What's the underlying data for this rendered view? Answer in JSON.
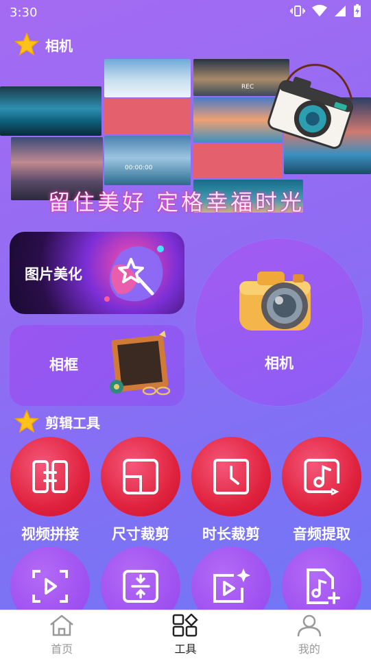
{
  "status_bar": {
    "time": "3:30"
  },
  "sections": {
    "camera_title": "相机",
    "edit_title": "剪辑工具"
  },
  "banner": {
    "caption": "留住美好  定格幸福时光",
    "rec_label": "REC",
    "timecode": "00:00:00"
  },
  "cards": {
    "beautify": "图片美化",
    "frame": "相框",
    "camera": "相机"
  },
  "tools_row1": [
    {
      "label": "视频拼接",
      "icon": "video-join-icon"
    },
    {
      "label": "尺寸裁剪",
      "icon": "resize-crop-icon"
    },
    {
      "label": "时长裁剪",
      "icon": "duration-crop-icon"
    },
    {
      "label": "音频提取",
      "icon": "audio-extract-icon"
    }
  ],
  "tools_row2": [
    {
      "icon": "scan-video-icon"
    },
    {
      "icon": "compress-icon"
    },
    {
      "icon": "video-effect-icon"
    },
    {
      "icon": "music-add-icon"
    }
  ],
  "bottom_nav": [
    {
      "label": "首页",
      "icon": "home-icon",
      "active": false
    },
    {
      "label": "工具",
      "icon": "grid-tools-icon",
      "active": true
    },
    {
      "label": "我的",
      "icon": "user-icon",
      "active": false
    }
  ],
  "colors": {
    "accent_red": "#e0233e",
    "accent_purple": "#9d4ff0",
    "background_start": "#a46bf2",
    "background_end": "#6c78f6"
  }
}
